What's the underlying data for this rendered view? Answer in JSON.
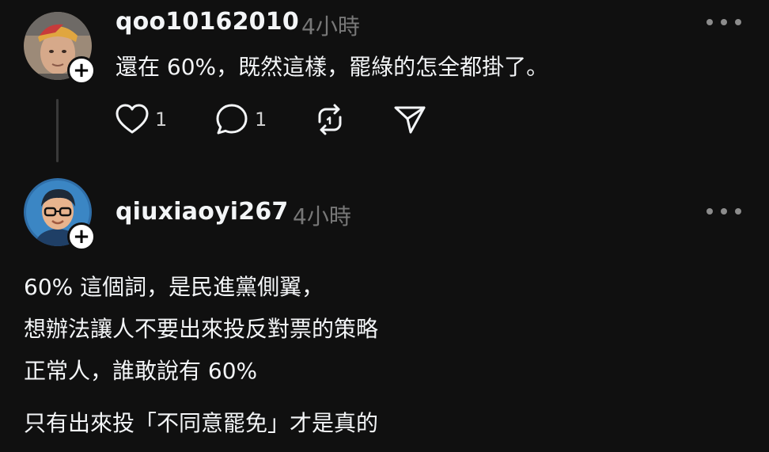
{
  "post1": {
    "username": "qoo10162010",
    "time": "4小時",
    "text": "還在 60%，既然這樣，罷綠的怎全都掛了。",
    "likes": "1",
    "replies": "1",
    "follow_label": "+"
  },
  "post2": {
    "username": "qiuxiaoyi267",
    "time": "4小時",
    "follow_label": "+",
    "lines": [
      "60% 這個詞，是民進黨側翼，",
      "想辦法讓人不要出來投反對票的策略",
      "正常人，誰敢說有 60%",
      "只有出來投「不同意罷免」才是真的"
    ]
  },
  "icons": [
    "heart-icon",
    "comment-icon",
    "repost-icon",
    "share-icon",
    "more-icon",
    "plus-icon"
  ],
  "colors": {
    "background": "#101010",
    "text": "#f3f5f7",
    "muted": "#777777"
  }
}
